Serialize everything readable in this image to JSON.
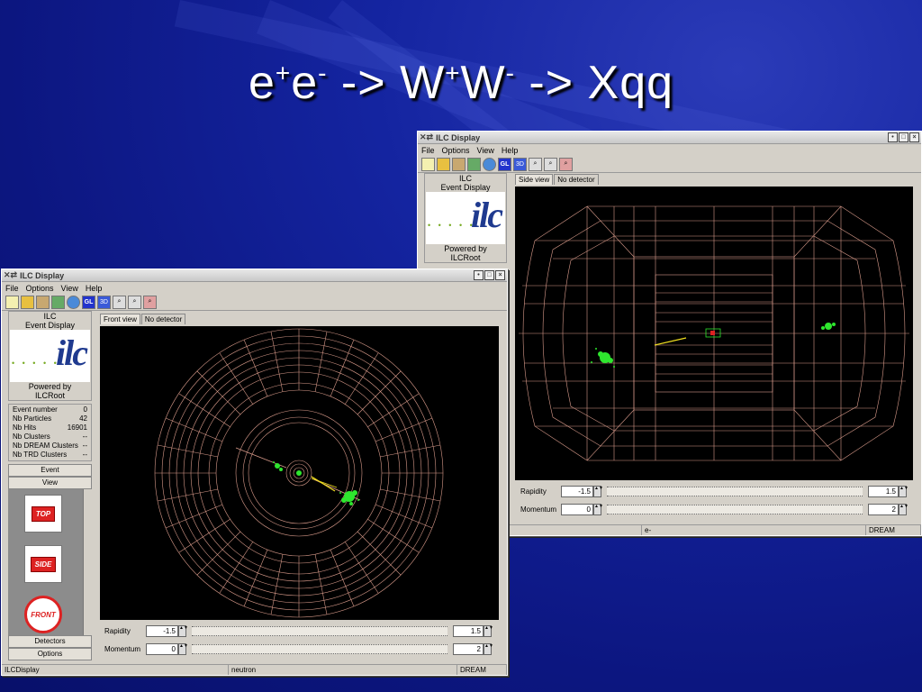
{
  "slide": {
    "title_parts": [
      "e",
      "+",
      "e",
      "-",
      " -> W",
      "+",
      "W",
      "-",
      " -> Xqq"
    ]
  },
  "colors": {
    "detector": "#d89a8a",
    "hits": "#2ee62e",
    "track": "#f2e020",
    "background": "#1424a0"
  },
  "window_back": {
    "title": "ILC Display",
    "menu": [
      "File",
      "Options",
      "View",
      "Help"
    ],
    "logo": {
      "line1": "ILC",
      "line2": "Event Display",
      "mark": "ilc",
      "powered": "Powered by",
      "root": "ILCRoot"
    },
    "tabs": [
      "Side view",
      "No detector"
    ],
    "rapidity": {
      "label": "Rapidity",
      "min": "-1.5",
      "max": "1.5"
    },
    "momentum": {
      "label": "Momentum",
      "min": "0",
      "max": "2"
    },
    "status": [
      "",
      "e-",
      "DREAM"
    ]
  },
  "window_front": {
    "title": "ILC Display",
    "menu": [
      "File",
      "Options",
      "View",
      "Help"
    ],
    "logo": {
      "line1": "ILC",
      "line2": "Event Display",
      "mark": "ilc",
      "powered": "Powered by",
      "root": "ILCRoot"
    },
    "info": [
      {
        "label": "Event number",
        "value": "0"
      },
      {
        "label": "Nb Particles",
        "value": "42"
      },
      {
        "label": "Nb Hits",
        "value": "16901"
      },
      {
        "label": "Nb Clusters",
        "value": "--"
      },
      {
        "label": "Nb DREAM Clusters",
        "value": "--"
      },
      {
        "label": "Nb TRD Clusters",
        "value": "--"
      }
    ],
    "nav": {
      "event": "Event",
      "view": "View",
      "detectors": "Detectors",
      "options": "Options"
    },
    "view_icons": [
      "TOP",
      "SIDE",
      "FRONT"
    ],
    "tabs": [
      "Front view",
      "No detector"
    ],
    "rapidity": {
      "label": "Rapidity",
      "min": "-1.5",
      "max": "1.5"
    },
    "momentum": {
      "label": "Momentum",
      "min": "0",
      "max": "2"
    },
    "status": [
      "ILCDisplay",
      "neutron",
      "DREAM"
    ]
  }
}
